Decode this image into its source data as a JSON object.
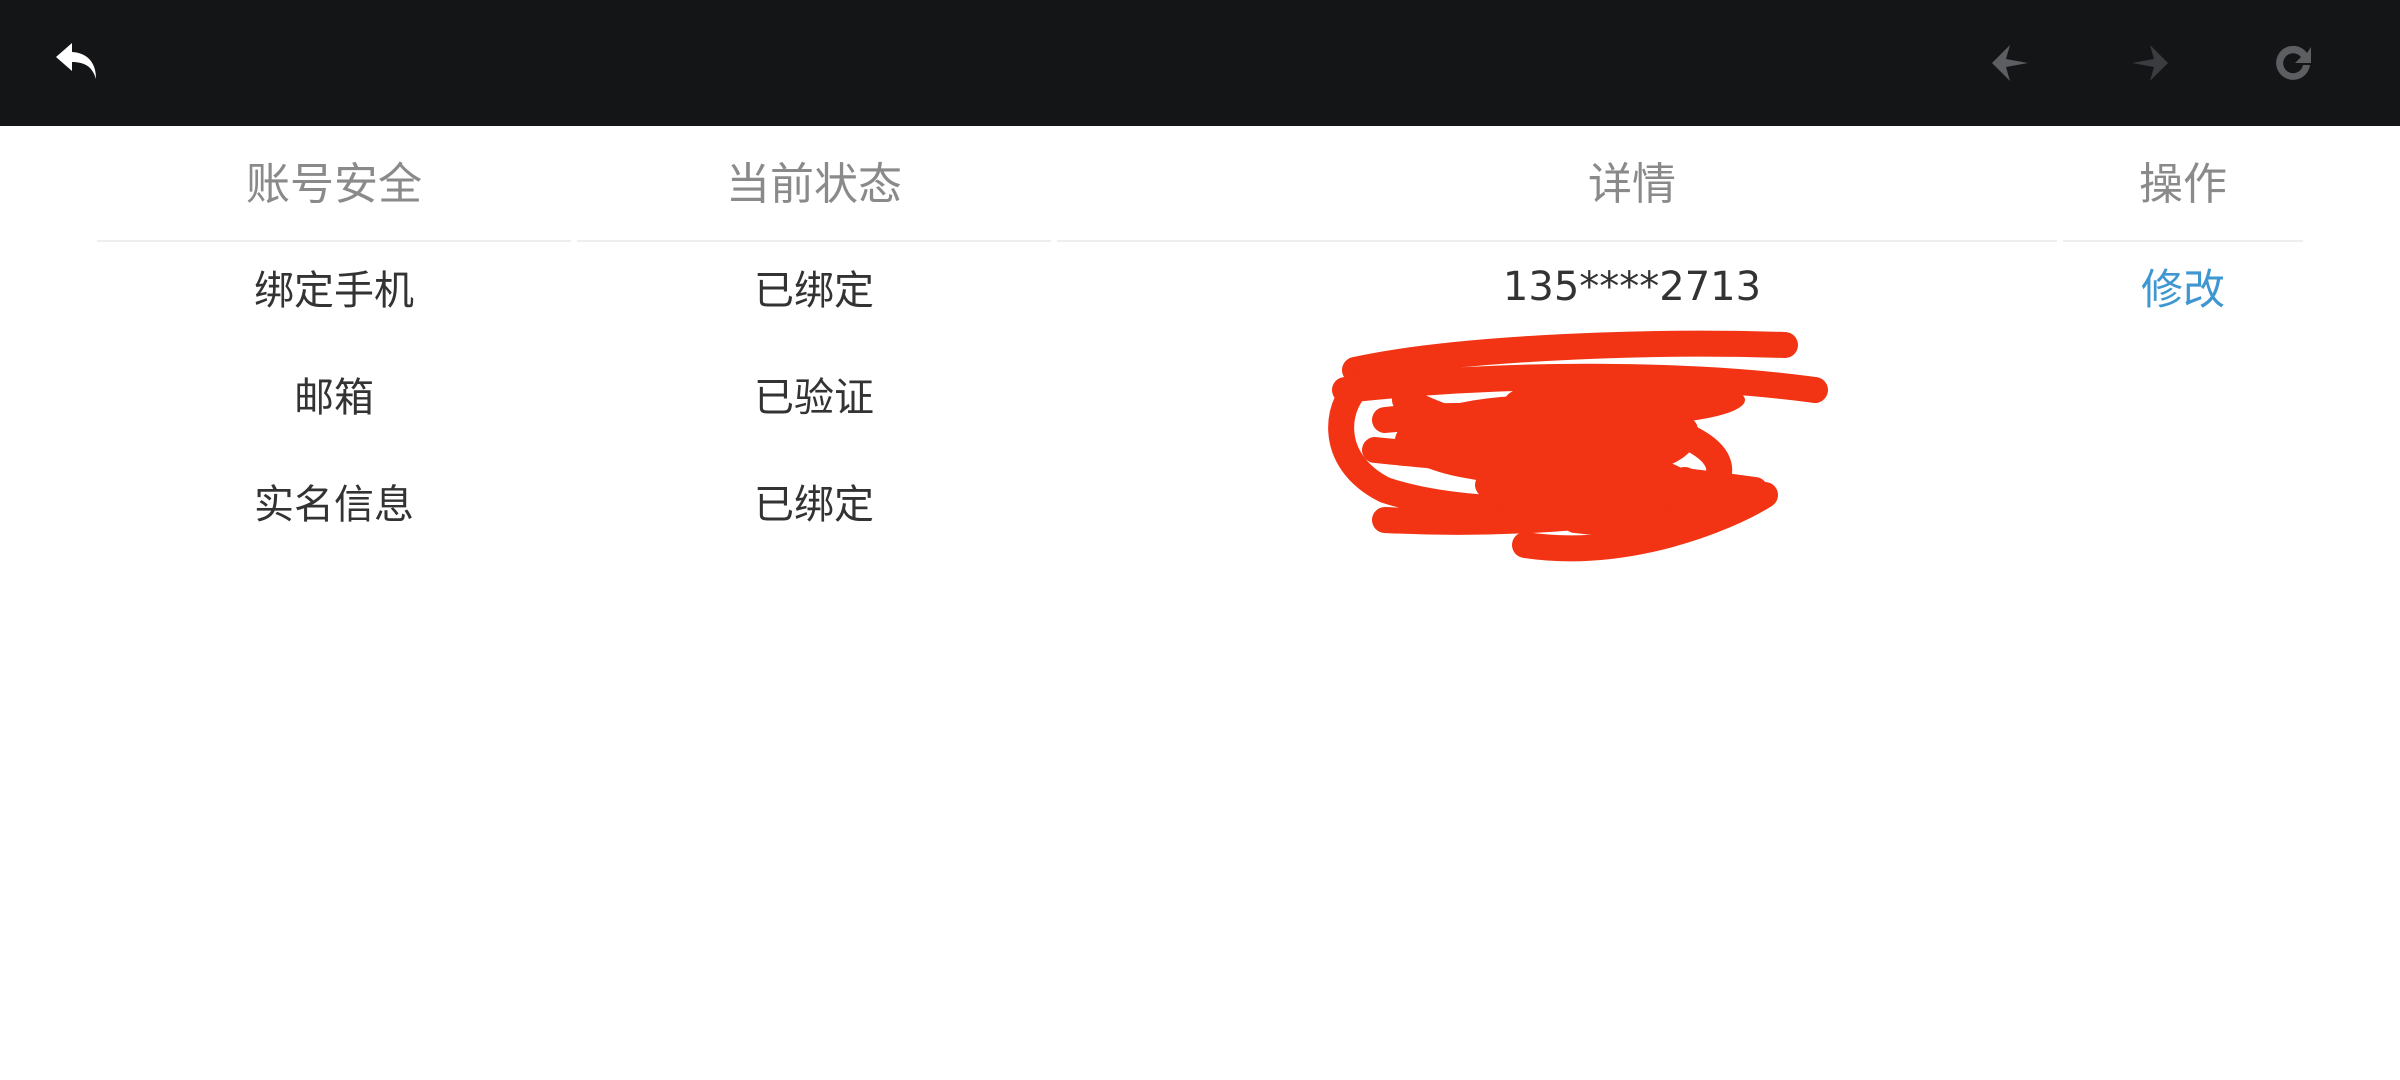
{
  "toolbar": {
    "back_icon": "back-arrow-icon",
    "prev_icon": "previous-arrow-icon",
    "next_icon": "next-arrow-icon",
    "refresh_icon": "refresh-icon",
    "background_color": "#141517"
  },
  "table": {
    "headers": [
      "账号安全",
      "当前状态",
      "详情",
      "操作"
    ],
    "rows": [
      {
        "item": "绑定手机",
        "status": "已绑定",
        "detail": "135****2713",
        "action": "修改"
      },
      {
        "item": "邮箱",
        "status": "已验证",
        "detail": "",
        "action": ""
      },
      {
        "item": "实名信息",
        "status": "已绑定",
        "detail": "",
        "action": ""
      }
    ]
  },
  "colors": {
    "header_text": "#8a8a8a",
    "body_text": "#333333",
    "link": "#3f97d1",
    "redaction": "#f23314"
  }
}
